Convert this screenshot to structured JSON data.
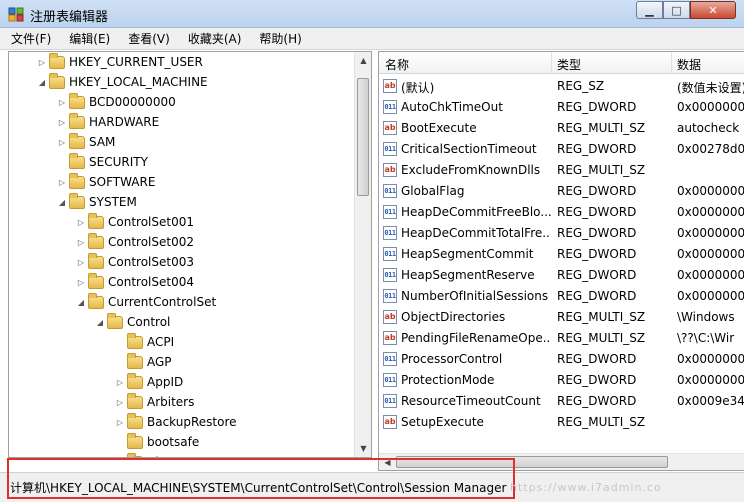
{
  "window": {
    "title": "注册表编辑器"
  },
  "menu": [
    "文件(F)",
    "编辑(E)",
    "查看(V)",
    "收藏夹(A)",
    "帮助(H)"
  ],
  "tree": [
    {
      "label": "HKEY_CURRENT_USER",
      "level": 0,
      "state": "collapsed"
    },
    {
      "label": "HKEY_LOCAL_MACHINE",
      "level": 0,
      "state": "expanded"
    },
    {
      "label": "BCD00000000",
      "level": 1,
      "state": "collapsed"
    },
    {
      "label": "HARDWARE",
      "level": 1,
      "state": "collapsed"
    },
    {
      "label": "SAM",
      "level": 1,
      "state": "collapsed"
    },
    {
      "label": "SECURITY",
      "level": 1,
      "state": "leaf"
    },
    {
      "label": "SOFTWARE",
      "level": 1,
      "state": "collapsed"
    },
    {
      "label": "SYSTEM",
      "level": 1,
      "state": "expanded"
    },
    {
      "label": "ControlSet001",
      "level": 2,
      "state": "collapsed"
    },
    {
      "label": "ControlSet002",
      "level": 2,
      "state": "collapsed"
    },
    {
      "label": "ControlSet003",
      "level": 2,
      "state": "collapsed"
    },
    {
      "label": "ControlSet004",
      "level": 2,
      "state": "collapsed"
    },
    {
      "label": "CurrentControlSet",
      "level": 2,
      "state": "expanded"
    },
    {
      "label": "Control",
      "level": 3,
      "state": "expanded"
    },
    {
      "label": "ACPI",
      "level": 4,
      "state": "leaf"
    },
    {
      "label": "AGP",
      "level": 4,
      "state": "leaf"
    },
    {
      "label": "AppID",
      "level": 4,
      "state": "collapsed"
    },
    {
      "label": "Arbiters",
      "level": 4,
      "state": "collapsed"
    },
    {
      "label": "BackupRestore",
      "level": 4,
      "state": "collapsed"
    },
    {
      "label": "bootsafe",
      "level": 4,
      "state": "leaf"
    },
    {
      "label": "Class",
      "level": 4,
      "state": "collapsed"
    }
  ],
  "columns": {
    "name": "名称",
    "type": "类型",
    "data": "数据"
  },
  "values": [
    {
      "name": "(默认)",
      "type": "REG_SZ",
      "data": "(数值未设置)",
      "icon": "string"
    },
    {
      "name": "AutoChkTimeOut",
      "type": "REG_DWORD",
      "data": "0x0000000",
      "icon": "binary"
    },
    {
      "name": "BootExecute",
      "type": "REG_MULTI_SZ",
      "data": "autocheck",
      "icon": "string"
    },
    {
      "name": "CriticalSectionTimeout",
      "type": "REG_DWORD",
      "data": "0x00278d0",
      "icon": "binary"
    },
    {
      "name": "ExcludeFromKnownDlls",
      "type": "REG_MULTI_SZ",
      "data": "",
      "icon": "string"
    },
    {
      "name": "GlobalFlag",
      "type": "REG_DWORD",
      "data": "0x0000000",
      "icon": "binary"
    },
    {
      "name": "HeapDeCommitFreeBlo...",
      "type": "REG_DWORD",
      "data": "0x0000000",
      "icon": "binary"
    },
    {
      "name": "HeapDeCommitTotalFre...",
      "type": "REG_DWORD",
      "data": "0x0000000",
      "icon": "binary"
    },
    {
      "name": "HeapSegmentCommit",
      "type": "REG_DWORD",
      "data": "0x0000000",
      "icon": "binary"
    },
    {
      "name": "HeapSegmentReserve",
      "type": "REG_DWORD",
      "data": "0x0000000",
      "icon": "binary"
    },
    {
      "name": "NumberOfInitialSessions",
      "type": "REG_DWORD",
      "data": "0x0000000",
      "icon": "binary"
    },
    {
      "name": "ObjectDirectories",
      "type": "REG_MULTI_SZ",
      "data": "\\Windows",
      "icon": "string"
    },
    {
      "name": "PendingFileRenameOpe...",
      "type": "REG_MULTI_SZ",
      "data": "\\??\\C:\\Wir",
      "icon": "string"
    },
    {
      "name": "ProcessorControl",
      "type": "REG_DWORD",
      "data": "0x0000000",
      "icon": "binary"
    },
    {
      "name": "ProtectionMode",
      "type": "REG_DWORD",
      "data": "0x0000000",
      "icon": "binary"
    },
    {
      "name": "ResourceTimeoutCount",
      "type": "REG_DWORD",
      "data": "0x0009e34",
      "icon": "binary"
    },
    {
      "name": "SetupExecute",
      "type": "REG_MULTI_SZ",
      "data": "",
      "icon": "string"
    }
  ],
  "status": {
    "path": "计算机\\HKEY_LOCAL_MACHINE\\SYSTEM\\CurrentControlSet\\Control\\Session Manager"
  },
  "watermark": "https://www.i7admin.co",
  "colors": {
    "highlight_box": "#e0302e",
    "folder": "#e5b84a",
    "title_bar": "#cfe0f4"
  }
}
